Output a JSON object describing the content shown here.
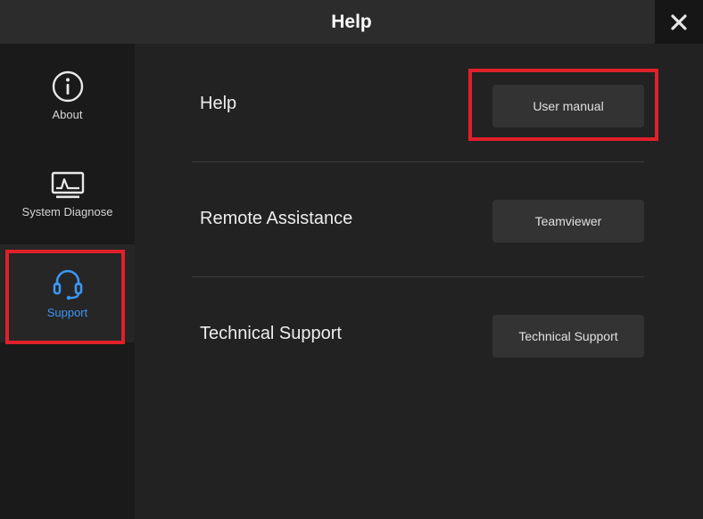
{
  "window": {
    "title": "Help"
  },
  "sidebar": {
    "items": [
      {
        "label": "About",
        "icon": "info-icon",
        "active": false
      },
      {
        "label": "System Diagnose",
        "icon": "monitor-icon",
        "active": false
      },
      {
        "label": "Support",
        "icon": "headset-icon",
        "active": true
      }
    ]
  },
  "main": {
    "rows": [
      {
        "label": "Help",
        "button_label": "User manual"
      },
      {
        "label": "Remote Assistance",
        "button_label": "Teamviewer"
      },
      {
        "label": "Technical Support",
        "button_label": "Technical Support"
      }
    ]
  },
  "colors": {
    "accent": "#3d96f5",
    "highlight": "#e0202a",
    "background": "#222222"
  }
}
